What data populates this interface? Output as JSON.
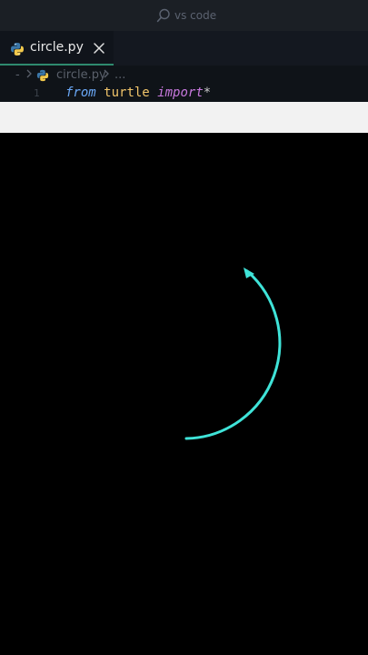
{
  "titlebar": {
    "search_text": "vs code",
    "search_icon": "search-icon"
  },
  "tabs": [
    {
      "label": "circle.py",
      "icon": "python-icon",
      "close_icon": "close-icon",
      "active": true
    }
  ],
  "breadcrumb": {
    "dash": "-",
    "file": "circle.py",
    "ellipsis": "..."
  },
  "editor": {
    "line_number": "1",
    "code": {
      "keyword_from": "from",
      "module": "turtle",
      "keyword_import": "import",
      "wildcard": "*"
    }
  },
  "colors": {
    "accent_tab_underline": "#2e8a6e",
    "turtle_pen": "#3fe3d8",
    "canvas_bg": "#000000"
  },
  "turtle_drawing": {
    "shape": "arc",
    "pen_color": "turquoise",
    "heading_icon": "turtle-arrow-icon"
  }
}
